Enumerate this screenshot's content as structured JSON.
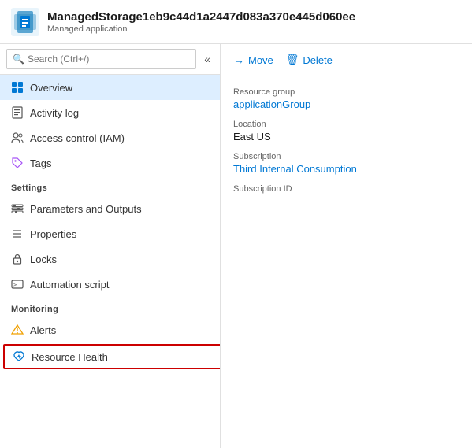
{
  "header": {
    "title": "ManagedStorage1eb9c44d1a2447d083a370e445d060ee",
    "subtitle": "Managed application"
  },
  "search": {
    "placeholder": "Search (Ctrl+/)"
  },
  "sidebar": {
    "collapse_label": "«",
    "nav_items": [
      {
        "id": "overview",
        "label": "Overview",
        "active": true,
        "icon": "overview"
      },
      {
        "id": "activity-log",
        "label": "Activity log",
        "active": false,
        "icon": "activity-log"
      },
      {
        "id": "access-control",
        "label": "Access control (IAM)",
        "active": false,
        "icon": "access-control"
      },
      {
        "id": "tags",
        "label": "Tags",
        "active": false,
        "icon": "tags"
      }
    ],
    "sections": [
      {
        "id": "settings",
        "label": "Settings",
        "items": [
          {
            "id": "parameters-outputs",
            "label": "Parameters and Outputs",
            "icon": "parameters"
          },
          {
            "id": "properties",
            "label": "Properties",
            "icon": "properties"
          },
          {
            "id": "locks",
            "label": "Locks",
            "icon": "locks"
          },
          {
            "id": "automation-script",
            "label": "Automation script",
            "icon": "automation"
          }
        ]
      },
      {
        "id": "monitoring",
        "label": "Monitoring",
        "items": [
          {
            "id": "alerts",
            "label": "Alerts",
            "icon": "alerts"
          },
          {
            "id": "resource-health",
            "label": "Resource Health",
            "icon": "resource-health",
            "highlighted": true
          }
        ]
      }
    ]
  },
  "toolbar": {
    "move_label": "Move",
    "delete_label": "Delete"
  },
  "details": {
    "resource_group_label": "Resource group",
    "resource_group_value": "applicationGroup",
    "location_label": "Location",
    "location_value": "East US",
    "subscription_label": "Subscription",
    "subscription_value": "Third Internal Consumption",
    "subscription_id_label": "Subscription ID",
    "subscription_id_value": ""
  },
  "colors": {
    "accent": "#0078d4",
    "active_bg": "#ddeeff",
    "highlight_border": "#cc0000"
  }
}
